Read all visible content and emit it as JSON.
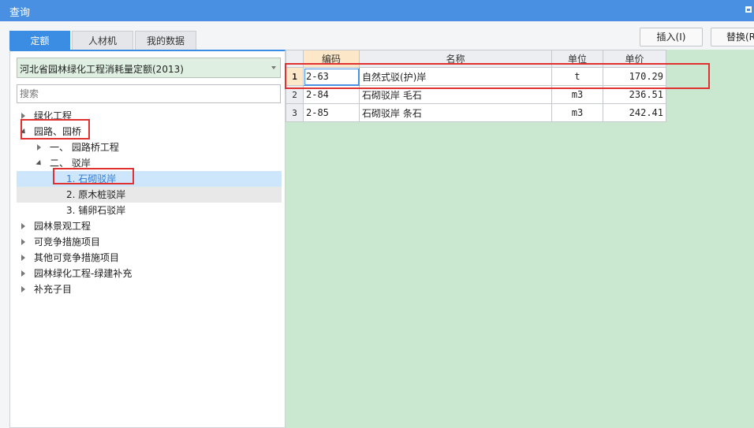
{
  "window": {
    "title": "查询"
  },
  "tabs": [
    {
      "label": "定额",
      "active": true
    },
    {
      "label": "人材机",
      "active": false
    },
    {
      "label": "我的数据",
      "active": false
    }
  ],
  "toolbar": {
    "insert_label": "插入(I)",
    "replace_label": "替换(R"
  },
  "left": {
    "quota_library": "河北省园林绿化工程消耗量定额(2013)",
    "search_placeholder": "搜索",
    "tree": [
      {
        "label": "绿化工程",
        "level": 0,
        "expanded": false,
        "selected": false
      },
      {
        "label": "园路、园桥",
        "level": 0,
        "expanded": true,
        "selected": false
      },
      {
        "label": "一、 园路桥工程",
        "level": 1,
        "expanded": false,
        "selected": false
      },
      {
        "label": "二、 驳岸",
        "level": 1,
        "expanded": true,
        "selected": false
      },
      {
        "label": "1. 石砌驳岸",
        "level": 2,
        "expanded": null,
        "selected": true
      },
      {
        "label": "2. 原木桩驳岸",
        "level": 2,
        "expanded": null,
        "selected": false
      },
      {
        "label": "3. 铺卵石驳岸",
        "level": 2,
        "expanded": null,
        "selected": false
      },
      {
        "label": "园林景观工程",
        "level": 0,
        "expanded": false,
        "selected": false
      },
      {
        "label": "可竞争措施项目",
        "level": 0,
        "expanded": false,
        "selected": false
      },
      {
        "label": "其他可竞争措施项目",
        "level": 0,
        "expanded": false,
        "selected": false
      },
      {
        "label": "园林绿化工程-绿建补充",
        "level": 0,
        "expanded": false,
        "selected": false
      },
      {
        "label": "补充子目",
        "level": 0,
        "expanded": false,
        "selected": false
      }
    ]
  },
  "grid": {
    "headers": {
      "code": "编码",
      "name": "名称",
      "unit": "单位",
      "price": "单价"
    },
    "rows": [
      {
        "num": "1",
        "code": "2-63",
        "name": "自然式驳(护)岸",
        "unit": "t",
        "price": "170.29",
        "current": true
      },
      {
        "num": "2",
        "code": "2-84",
        "name": "石砌驳岸 毛石",
        "unit": "m3",
        "price": "236.51",
        "current": false
      },
      {
        "num": "3",
        "code": "2-85",
        "name": "石砌驳岸 条石",
        "unit": "m3",
        "price": "242.41",
        "current": false
      }
    ]
  },
  "colors": {
    "accent": "#3b8de3",
    "titlebar": "#4a90e2",
    "selection_highlight": "#cde6fb",
    "grid_empty": "#c9e8cf",
    "annotation_red": "#e03030"
  }
}
